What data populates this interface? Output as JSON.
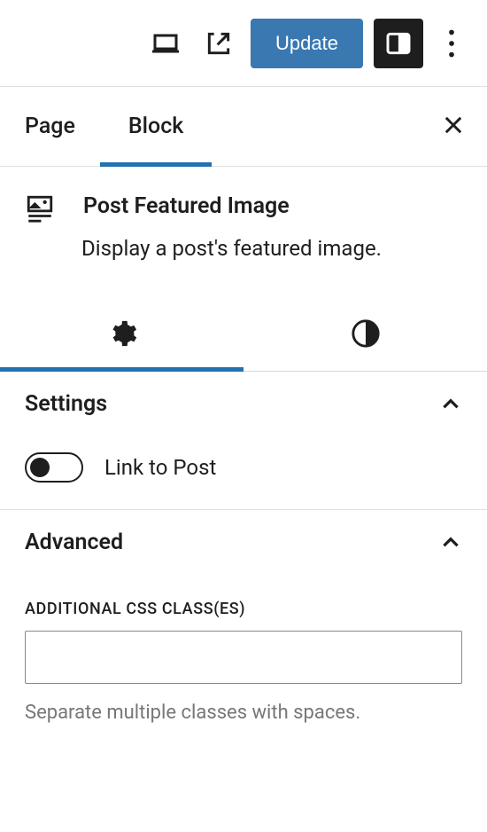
{
  "toolbar": {
    "update_label": "Update"
  },
  "tabs": {
    "page_label": "Page",
    "block_label": "Block"
  },
  "block": {
    "title": "Post Featured Image",
    "description": "Display a post's featured image."
  },
  "settings_panel": {
    "title": "Settings",
    "link_to_post_label": "Link to Post",
    "link_to_post_value": false
  },
  "advanced_panel": {
    "title": "Advanced",
    "css_field_label": "ADDITIONAL CSS CLASS(ES)",
    "css_value": "",
    "css_help": "Separate multiple classes with spaces."
  }
}
